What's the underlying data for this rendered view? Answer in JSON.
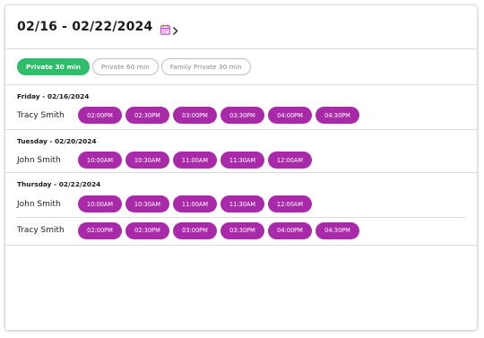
{
  "header": {
    "date_range": "02/16 - 02/22/2024"
  },
  "tabs": [
    {
      "label": "Private 30 min",
      "active": true
    },
    {
      "label": "Private 60 min",
      "active": false
    },
    {
      "label": "Family Private 30 min",
      "active": false
    }
  ],
  "days": [
    {
      "date": "Friday - 02/16/2024",
      "trainers": [
        {
          "name": "Tracy Smith",
          "slots": [
            "02:00PM",
            "02:30PM",
            "03:00PM",
            "03:30PM",
            "04:00PM",
            "04:30PM"
          ]
        }
      ]
    },
    {
      "date": "Tuesday - 02/20/2024",
      "trainers": [
        {
          "name": "John Smith",
          "slots": [
            "10:00AM",
            "10:30AM",
            "11:00AM",
            "11:30AM",
            "12:00AM"
          ]
        }
      ]
    },
    {
      "date": "Thursday - 02/22/2024",
      "trainers": [
        {
          "name": "John Smith",
          "slots": [
            "10:00AM",
            "10:30AM",
            "11:00AM",
            "11:30AM",
            "12:00AM"
          ]
        },
        {
          "name": "Tracy Smith",
          "slots": [
            "02:00PM",
            "02:30PM",
            "03:00PM",
            "03:30PM",
            "04:00PM",
            "04:30PM"
          ]
        }
      ]
    }
  ],
  "colors": {
    "active_tab": "#2ebd6b",
    "slot": "#a82aa8",
    "calendar_icon": "#b634b6"
  },
  "icons": {
    "calendar": "calendar-icon",
    "next": "chevron-right-icon"
  }
}
